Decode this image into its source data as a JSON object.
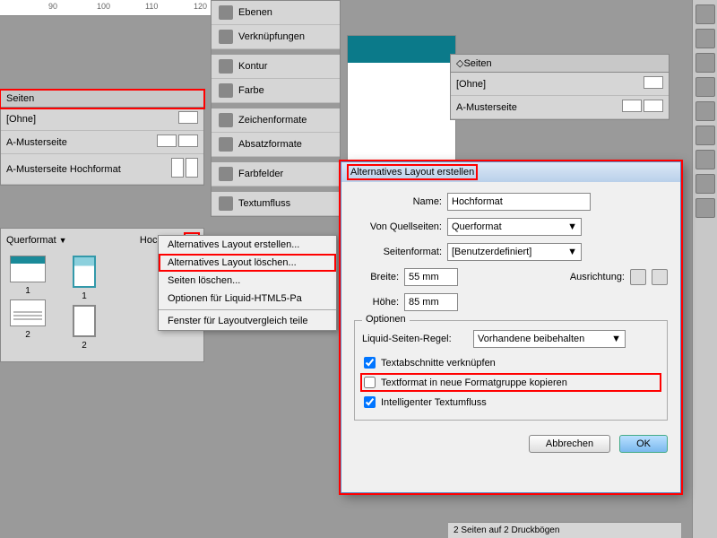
{
  "ruler": {
    "m90": "90",
    "m100": "100",
    "m110": "110",
    "m120": "120"
  },
  "panels": {
    "seiten": "Seiten",
    "ohne": "[Ohne]",
    "muster": "A-Musterseite",
    "musterH": "A-Musterseite Hochformat",
    "ebenen": "Ebenen",
    "verkn": "Verknüpfungen",
    "kontur": "Kontur",
    "farbe": "Farbe",
    "zeichen": "Zeichenformate",
    "absatz": "Absatzformate",
    "farbfelder": "Farbfelder",
    "textumfl": "Textumfluss"
  },
  "layouts": {
    "quer": "Querformat",
    "hoch": "Hochfor...",
    "p1": "1",
    "p2": "2"
  },
  "ctx": {
    "i1": "Alternatives Layout erstellen...",
    "i2": "Alternatives Layout löschen...",
    "i3": "Seiten löschen...",
    "i4": "Optionen für Liquid-HTML5-Pa",
    "i5": "Fenster für Layoutvergleich teile"
  },
  "dlg": {
    "title": "Alternatives Layout erstellen",
    "name_l": "Name:",
    "name_v": "Hochformat",
    "src_l": "Von Quellseiten:",
    "src_v": "Querformat",
    "fmt_l": "Seitenformat:",
    "fmt_v": "[Benutzerdefiniert]",
    "w_l": "Breite:",
    "w_v": "55 mm",
    "h_l": "Höhe:",
    "h_v": "85 mm",
    "orient_l": "Ausrichtung:",
    "opt": "Optionen",
    "liq_l": "Liquid-Seiten-Regel:",
    "liq_v": "Vorhandene beibehalten",
    "c1": "Textabschnitte verknüpfen",
    "c2": "Textformat in neue Formatgruppe kopieren",
    "c3": "Intelligenter Textumfluss",
    "cancel": "Abbrechen",
    "ok": "OK"
  },
  "status": "2 Seiten auf 2 Druckbögen"
}
